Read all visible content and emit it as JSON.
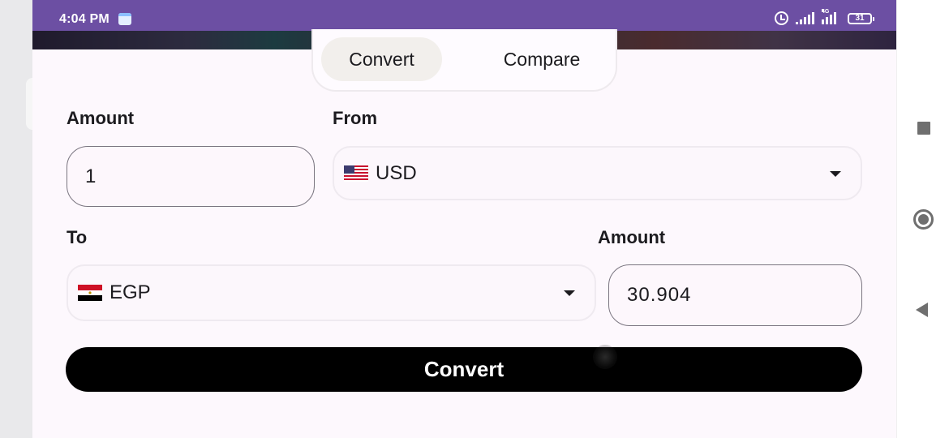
{
  "status_bar": {
    "time": "4:04 PM",
    "network_type": "4G",
    "battery": "31",
    "icons": [
      "calendar-icon",
      "alarm-icon",
      "signal-icon",
      "signal-4g-icon",
      "battery-icon"
    ]
  },
  "tabs": [
    {
      "label": "Convert",
      "selected": true
    },
    {
      "label": "Compare",
      "selected": false
    }
  ],
  "form": {
    "amount_label": "Amount",
    "amount_value": "1",
    "from_label": "From",
    "from_currency": "USD",
    "from_flag": "us-flag-icon",
    "to_label": "To",
    "to_currency": "EGP",
    "to_flag": "egypt-flag-icon",
    "result_label": "Amount",
    "result_value": "30.904",
    "convert_button": "Convert"
  },
  "nav_bar": {
    "icons": [
      "recents-square-icon",
      "home-circle-icon",
      "back-triangle-icon"
    ]
  },
  "colors": {
    "status_bar": "#6c4fa3",
    "app_background": "#fdf8fd",
    "button": "#000000",
    "button_text": "#ffffff",
    "selected_tab": "#f2efec"
  }
}
